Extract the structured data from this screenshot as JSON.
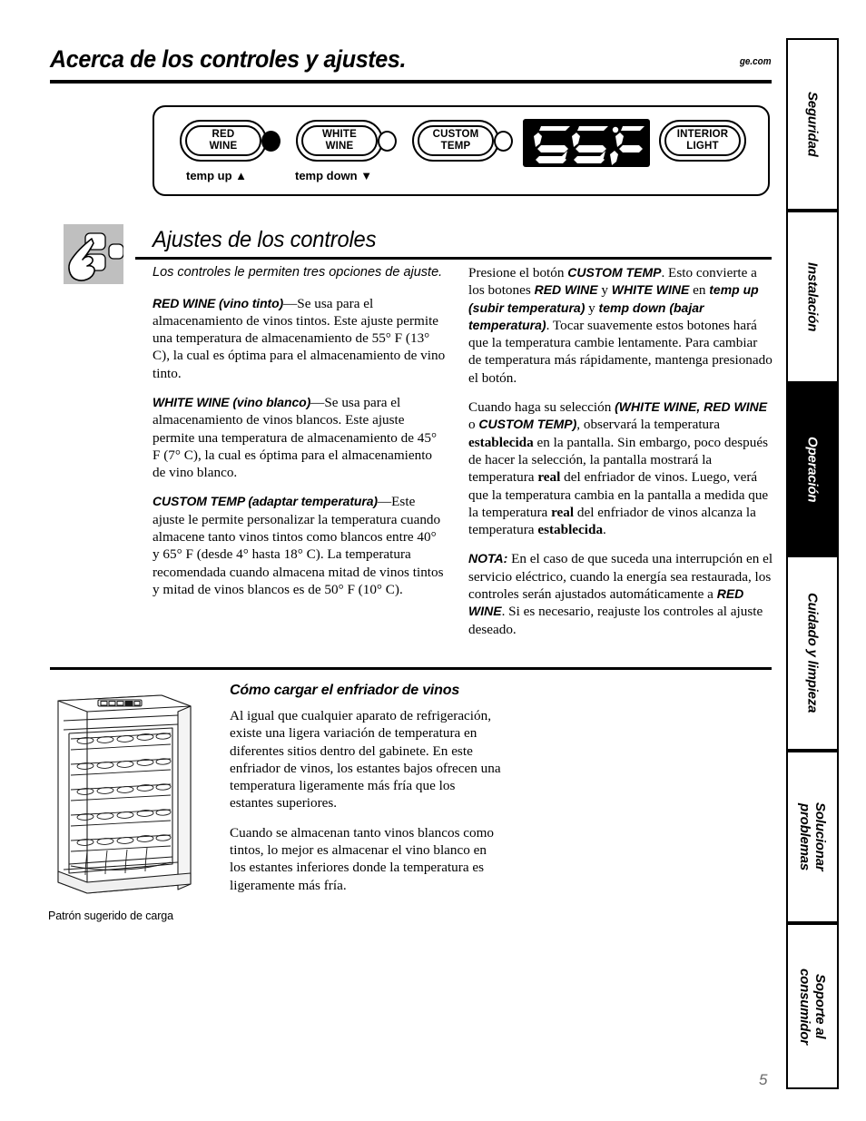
{
  "header": {
    "title": "Acerca de los controles y ajustes.",
    "url": "ge.com"
  },
  "control_panel": {
    "buttons": [
      {
        "line1": "RED",
        "line2": "WINE",
        "indicator": "filled",
        "sublabel": "temp up ▲"
      },
      {
        "line1": "WHITE",
        "line2": "WINE",
        "indicator": "empty",
        "sublabel": "temp down ▼"
      },
      {
        "line1": "CUSTOM",
        "line2": "TEMP",
        "indicator": "empty",
        "sublabel": ""
      },
      {
        "line1": "INTERIOR",
        "line2": "LIGHT",
        "indicator": "none",
        "sublabel": ""
      }
    ],
    "display_value": "55°F"
  },
  "section": {
    "title": "Ajustes de los controles",
    "icon": "hand-pressing-buttons-icon"
  },
  "left_column": {
    "intro": "Los controles le permiten tres opciones de ajuste.",
    "items": [
      {
        "head": "RED WINE (vino tinto)",
        "body": "—Se usa para el almacenamiento de vinos tintos. Este ajuste permite una temperatura de almacenamiento de 55° F (13° C), la cual es óptima para el almacenamiento de vino tinto."
      },
      {
        "head": "WHITE WINE (vino blanco)",
        "body": "—Se usa para el almacenamiento de vinos blancos. Este ajuste permite una temperatura de almacenamiento de 45° F (7° C), la cual es óptima para el almacenamiento de vino blanco."
      },
      {
        "head": "CUSTOM TEMP (adaptar temperatura)",
        "body": "—Este ajuste le permite personalizar la temperatura cuando almacene tanto vinos tintos como blancos entre 40° y 65° F (desde 4° hasta 18° C). La temperatura recomendada cuando almacena mitad de vinos tintos y mitad de vinos blancos es de 50° F (10° C)."
      }
    ]
  },
  "right_column": {
    "p1_a": "Presione el botón ",
    "p1_b": "CUSTOM TEMP",
    "p1_c": ". Esto convierte a los botones ",
    "p1_d": "RED WINE",
    "p1_e": " y ",
    "p1_f": "WHITE WINE",
    "p1_g": " en ",
    "p1_h": "temp up (subir temperatura)",
    "p1_i": " y ",
    "p1_j": "temp down (bajar temperatura)",
    "p1_k": ". Tocar suavemente estos botones hará que la temperatura cambie lentamente. Para cambiar de temperatura más rápidamente, mantenga presionado el botón.",
    "p2_a": "Cuando haga su selección ",
    "p2_b": "(WHITE WINE, RED WINE",
    "p2_c": " o ",
    "p2_d": "CUSTOM TEMP)",
    "p2_e": ", observará la temperatura ",
    "p2_f": "establecida",
    "p2_g": " en la pantalla. Sin embargo, poco después de hacer la selección, la pantalla mostrará la temperatura ",
    "p2_h": "real",
    "p2_i": " del enfriador de vinos. Luego, verá que la temperatura cambia en la pantalla a medida que la temperatura ",
    "p2_j": "real",
    "p2_k": " del enfriador de vinos alcanza la temperatura ",
    "p2_l": "establecida",
    "p2_m": ".",
    "note_label": "NOTA:",
    "note_a": " En el caso de que suceda una interrupción en el servicio eléctrico, cuando la energía sea restaurada, los controles serán ajustados automáticamente a ",
    "note_b": "RED WINE",
    "note_c": ". Si es necesario, reajuste los controles al ajuste deseado."
  },
  "bottom_section": {
    "title": "Cómo cargar el enfriador de vinos",
    "p1": "Al igual que cualquier aparato de refrigeración, existe una ligera variación de temperatura en diferentes sitios dentro del gabinete. En este enfriador de vinos, los estantes bajos ofrecen una temperatura ligeramente más fría que los estantes superiores.",
    "p2": "Cuando se almacenan tanto vinos blancos como tintos, lo mejor es almacenar el vino blanco en los estantes inferiores donde la temperatura es ligeramente más fría.",
    "image_caption": "Patrón sugerido de carga",
    "image_name": "wine-cooler-illustration"
  },
  "sidebar": {
    "tabs": [
      {
        "label": "Seguridad",
        "active": false
      },
      {
        "label": "Instalación",
        "active": false
      },
      {
        "label": "Operación",
        "active": true
      },
      {
        "label": "Cuidado y limpieza",
        "active": false
      },
      {
        "label": "Solucionar\nproblemas",
        "active": false
      },
      {
        "label": "Soporte al\nconsumidor",
        "active": false
      }
    ]
  },
  "page_number": "5"
}
